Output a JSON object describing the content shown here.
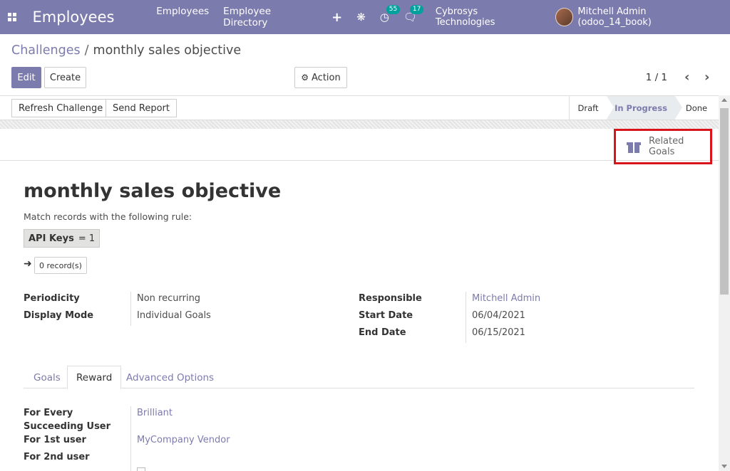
{
  "navbar": {
    "app_title": "Employees",
    "menu": [
      "Employees",
      "Employee Directory"
    ],
    "plus": "+",
    "activity_badge": "55",
    "messages_badge": "17",
    "company": "Cybrosys Technologies",
    "user": "Mitchell Admin (odoo_14_book)"
  },
  "breadcrumb": {
    "parent": "Challenges",
    "separator": "/",
    "current": "monthly sales objective"
  },
  "control": {
    "edit": "Edit",
    "create": "Create",
    "action": "Action",
    "pager": "1 / 1"
  },
  "statusbar": {
    "refresh": "Refresh Challenge",
    "send_report": "Send Report",
    "stages": [
      "Draft",
      "In Progress",
      "Done"
    ],
    "active_stage": "In Progress"
  },
  "smart_button": {
    "line1": "Related",
    "line2": "Goals"
  },
  "record": {
    "title": "monthly sales objective",
    "rule_label": "Match records with the following rule:",
    "domain_field": "API Keys",
    "domain_op": "= 1",
    "records_count": "0 record(s)"
  },
  "fields_left": [
    {
      "label": "Periodicity",
      "value": "Non recurring"
    },
    {
      "label": "Display Mode",
      "value": "Individual Goals"
    }
  ],
  "fields_right": [
    {
      "label": "Responsible",
      "value": "Mitchell Admin"
    },
    {
      "label": "Start Date",
      "value": "06/04/2021"
    },
    {
      "label": "End Date",
      "value": "06/15/2021"
    }
  ],
  "tabs": [
    "Goals",
    "Reward",
    "Advanced Options"
  ],
  "active_tab": "Reward",
  "reward": {
    "every_label_1": "For Every",
    "every_label_2": "Succeeding User",
    "every_value": "Brilliant",
    "first_label": "For 1st user",
    "first_value": "MyCompany Vendor",
    "second_label": "For 2nd user"
  },
  "colors": {
    "brand": "#7c7bad",
    "highlight": "#d8141c",
    "badge": "#00a09d"
  }
}
